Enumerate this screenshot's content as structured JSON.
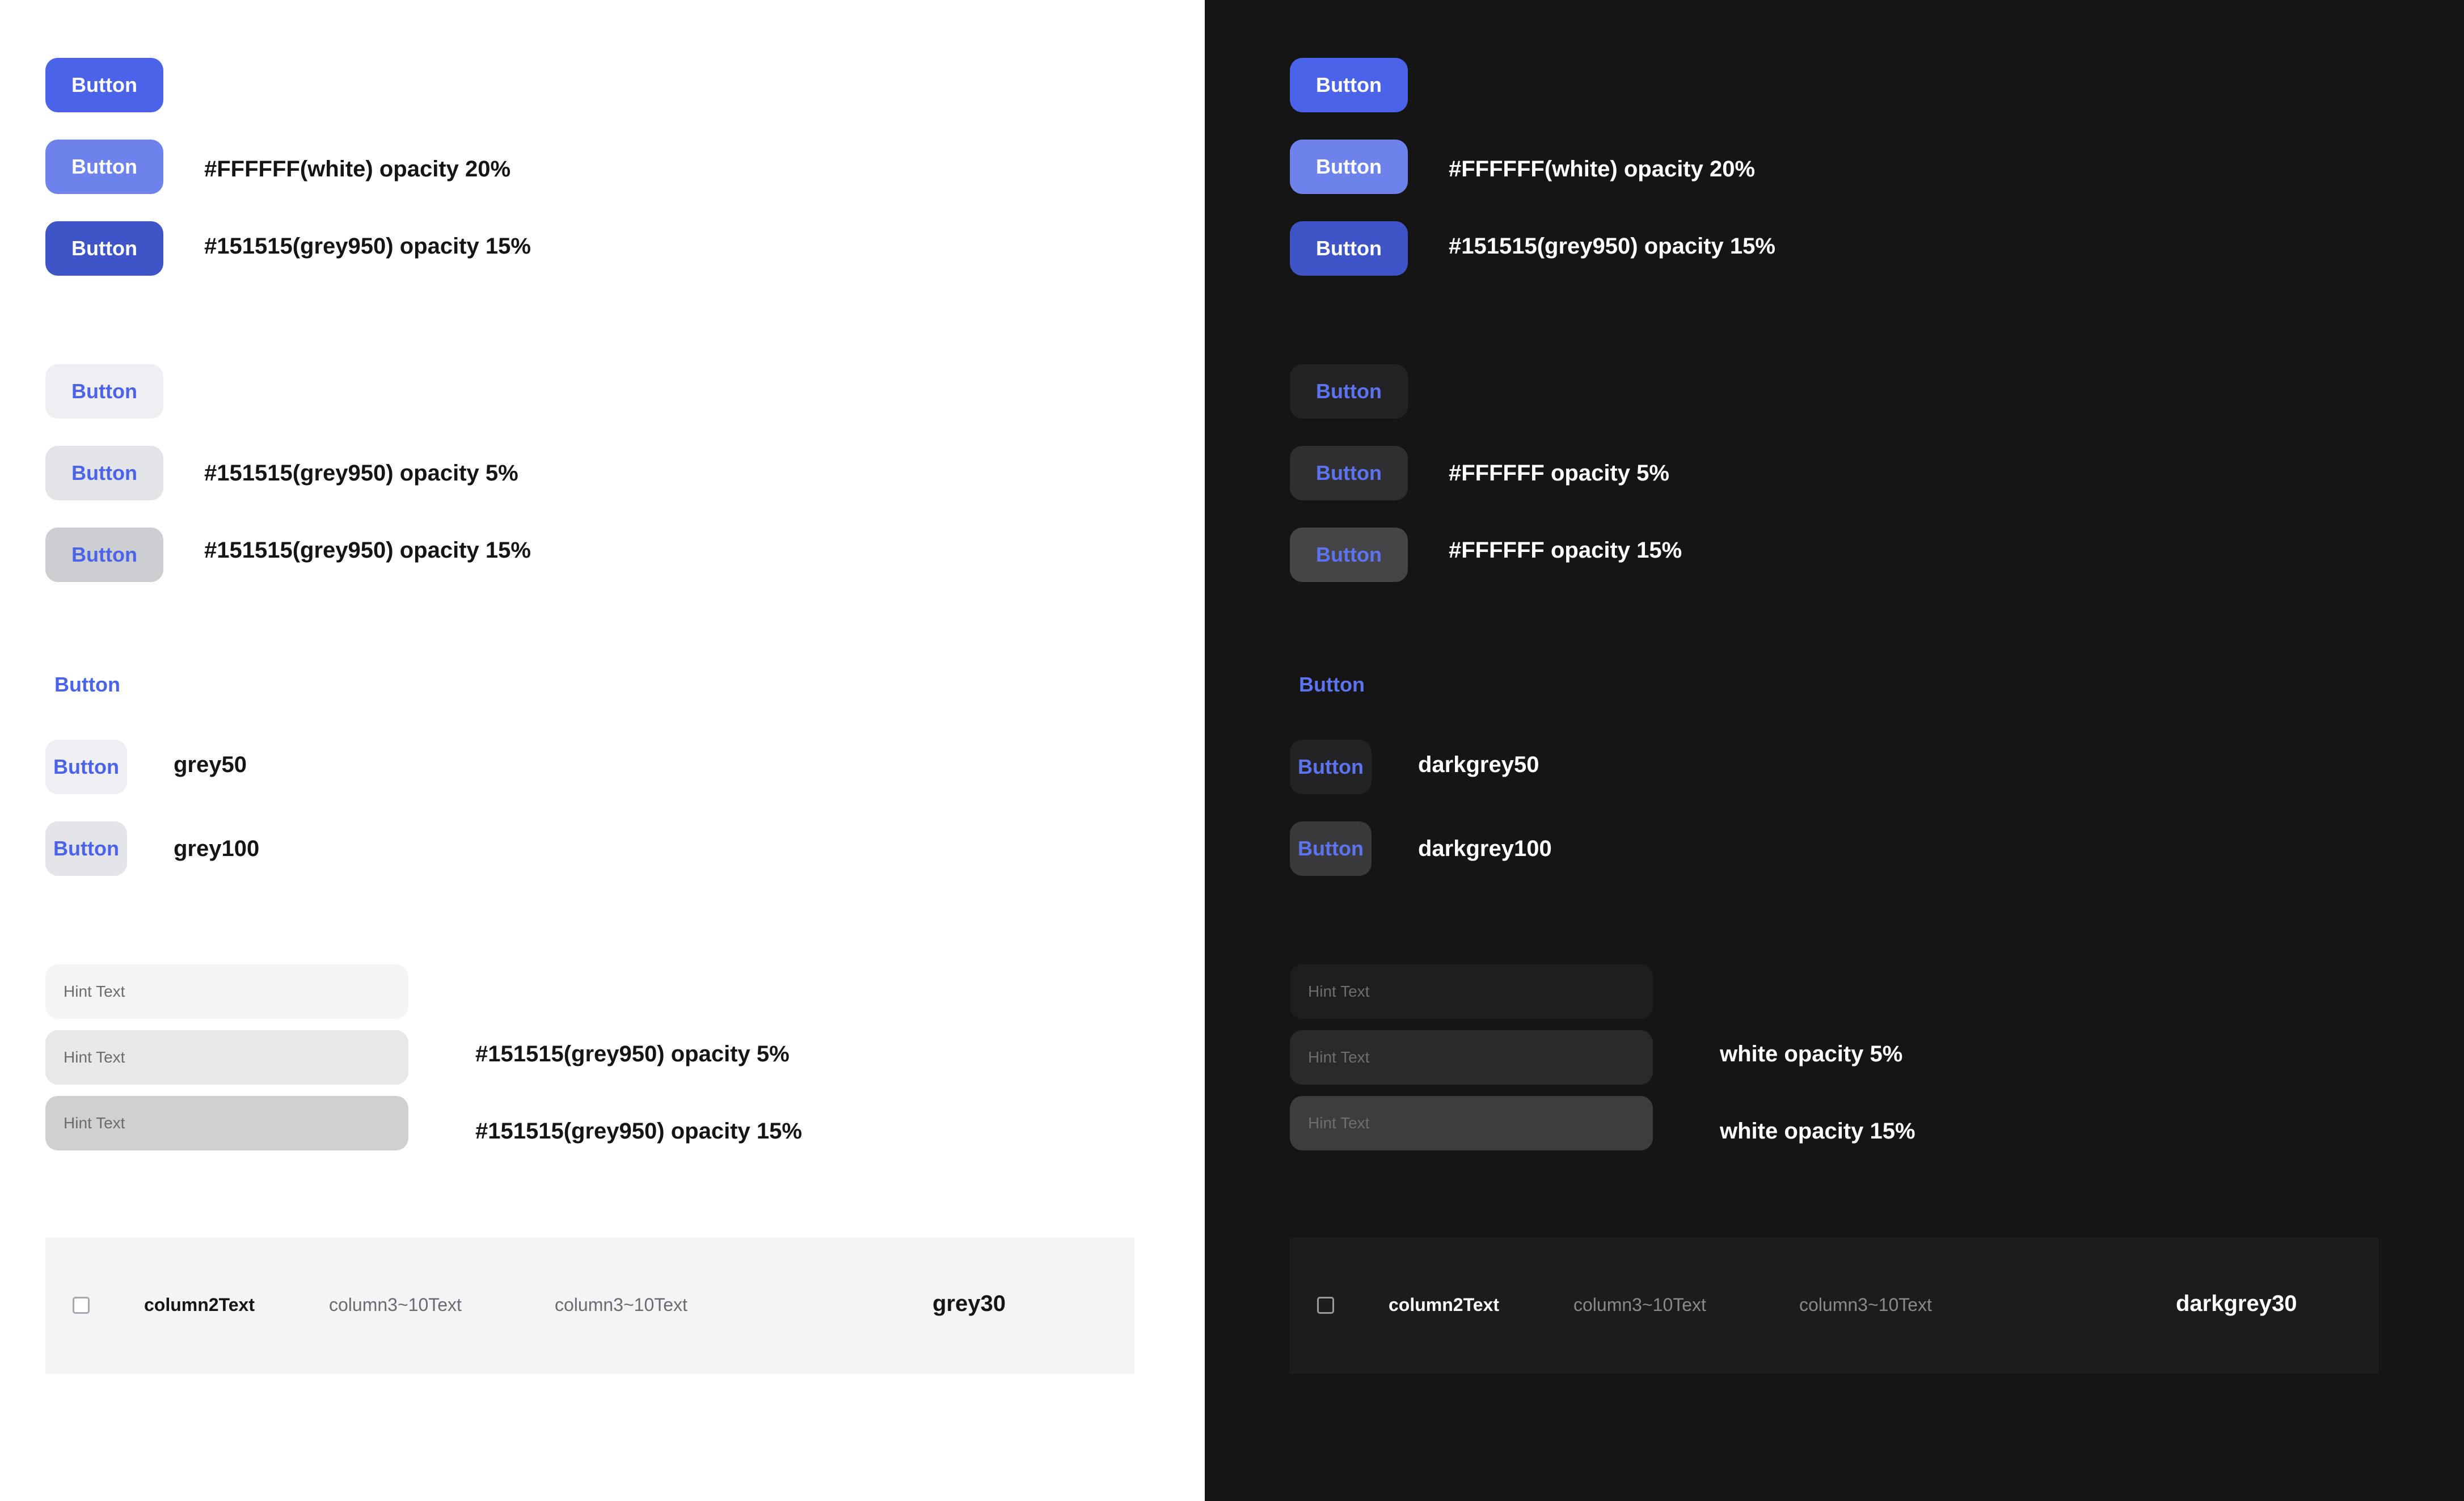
{
  "colors": {
    "light_background": "#FFFFFF",
    "dark_background": "#151515",
    "primary": "#4A63E8"
  },
  "light": {
    "primary": {
      "button_label": "Button",
      "hover_note": "#FFFFFF(white) opacity 20%",
      "pressed_note": "#151515(grey950) opacity 15%"
    },
    "secondary": {
      "button_label": "Button",
      "hover_note": "#151515(grey950) opacity 5%",
      "pressed_note": "#151515(grey950) opacity 15%"
    },
    "text_button": {
      "label": "Button",
      "grey50_label": "Button",
      "grey50_note": "grey50",
      "grey100_label": "Button",
      "grey100_note": "grey100"
    },
    "inputs": {
      "placeholder": "Hint Text",
      "hover_note": "#151515(grey950) opacity 5%",
      "pressed_note": "#151515(grey950) opacity 15%"
    },
    "table_row": {
      "column2": "column2Text",
      "column3": "column3~10Text",
      "column4": "column3~10Text",
      "note": "grey30"
    }
  },
  "dark": {
    "primary": {
      "button_label": "Button",
      "hover_note": "#FFFFFF(white) opacity 20%",
      "pressed_note": "#151515(grey950) opacity 15%"
    },
    "secondary": {
      "button_label": "Button",
      "hover_note": "#FFFFFF opacity 5%",
      "pressed_note": "#FFFFFF opacity 15%"
    },
    "text_button": {
      "label": "Button",
      "grey50_label": "Button",
      "grey50_note": "darkgrey50",
      "grey100_label": "Button",
      "grey100_note": "darkgrey100"
    },
    "inputs": {
      "placeholder": "Hint Text",
      "hover_note": "white opacity 5%",
      "pressed_note": "white opacity 15%"
    },
    "table_row": {
      "column2": "column2Text",
      "column3": "column3~10Text",
      "column4": "column3~10Text",
      "note": "darkgrey30"
    }
  }
}
